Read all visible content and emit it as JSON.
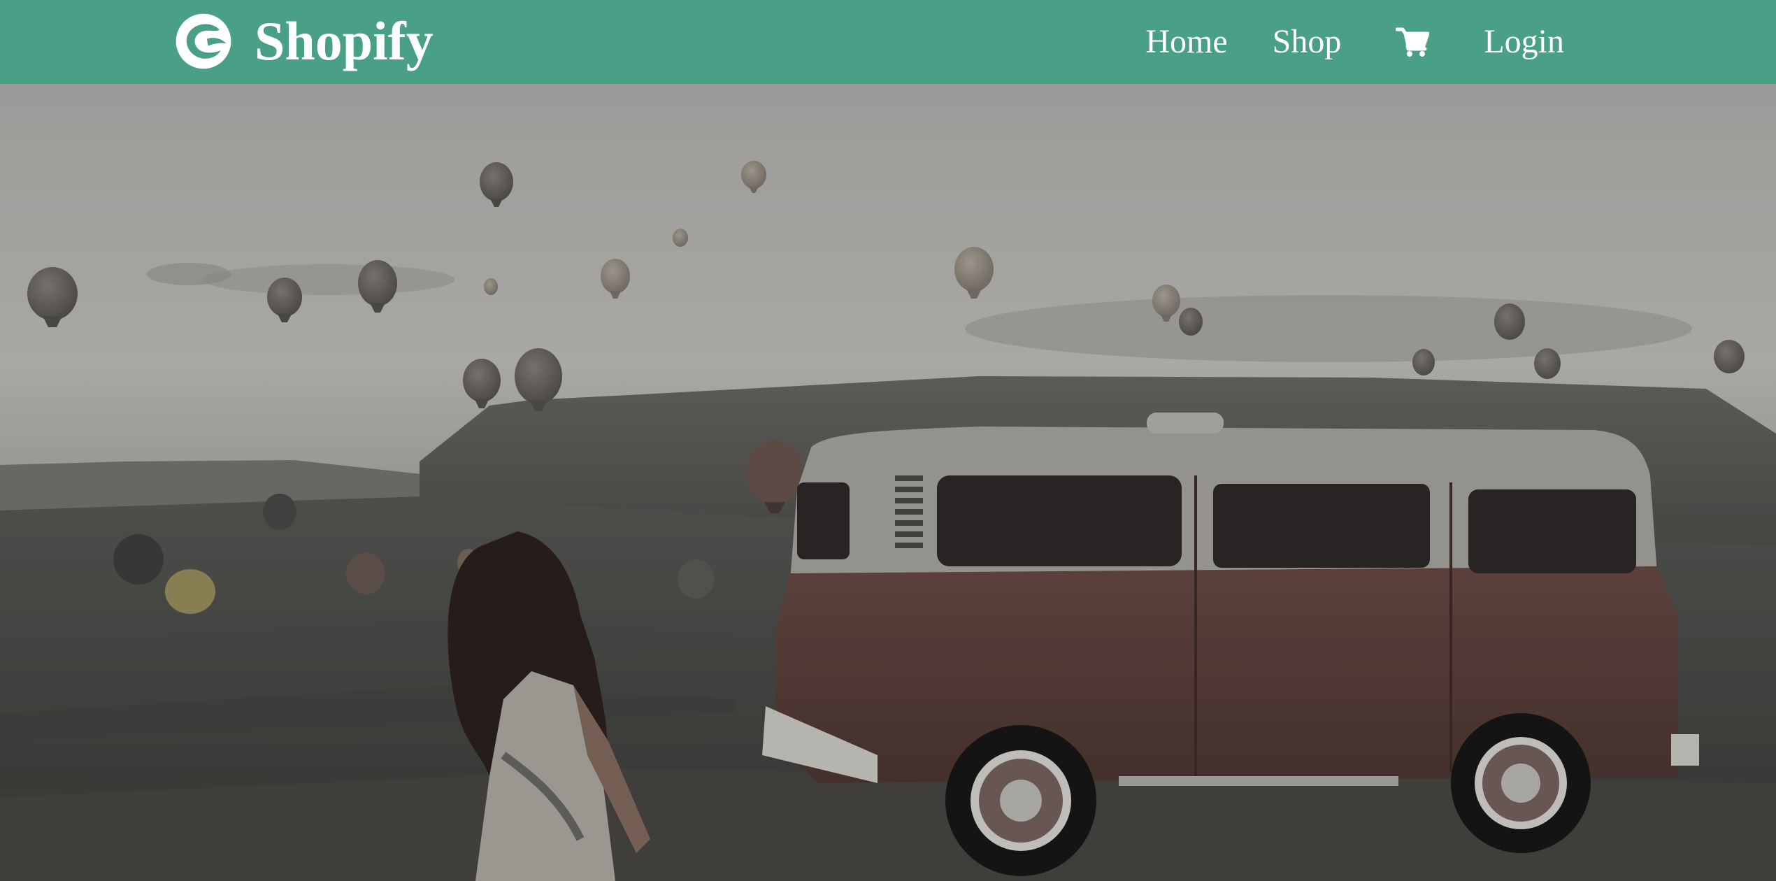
{
  "navbar": {
    "brand": "Shopify",
    "brand_icon": "shopify-logo-icon",
    "links": {
      "home": "Home",
      "shop": "Shop",
      "cart_icon": "shopping-cart-icon",
      "login": "Login"
    }
  },
  "colors": {
    "navbar_bg": "#4aa086",
    "nav_text": "#ffffff"
  },
  "hero": {
    "image": "hero-background-image"
  }
}
